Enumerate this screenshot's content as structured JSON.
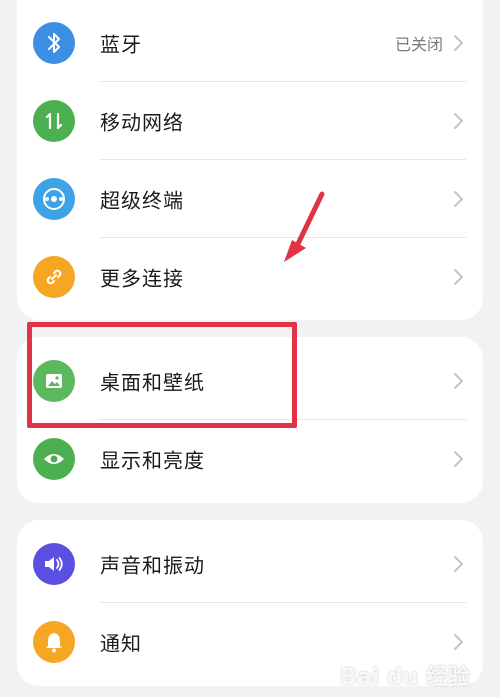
{
  "colors": {
    "bluetooth": "#3d8fe3",
    "mobile_network": "#4caf50",
    "super_device": "#3ea3e6",
    "more_connections": "#f5a623",
    "wallpaper": "#5cb85c",
    "display": "#4caf50",
    "sound": "#5a4fe0",
    "notifications": "#f5a623",
    "annotation": "#e03446"
  },
  "group_connectivity": [
    {
      "label": "蓝牙",
      "value": "已关闭",
      "icon": "bluetooth-icon"
    },
    {
      "label": "移动网络",
      "icon": "mobile-data-icon"
    },
    {
      "label": "超级终端",
      "icon": "super-device-icon"
    },
    {
      "label": "更多连接",
      "icon": "link-icon"
    }
  ],
  "group_display": [
    {
      "label": "桌面和壁纸",
      "icon": "image-icon"
    },
    {
      "label": "显示和亮度",
      "icon": "eye-icon"
    }
  ],
  "group_notify": [
    {
      "label": "声音和振动",
      "icon": "speaker-icon"
    },
    {
      "label": "通知",
      "icon": "bell-icon"
    }
  ],
  "watermark": "Bai du 经验"
}
